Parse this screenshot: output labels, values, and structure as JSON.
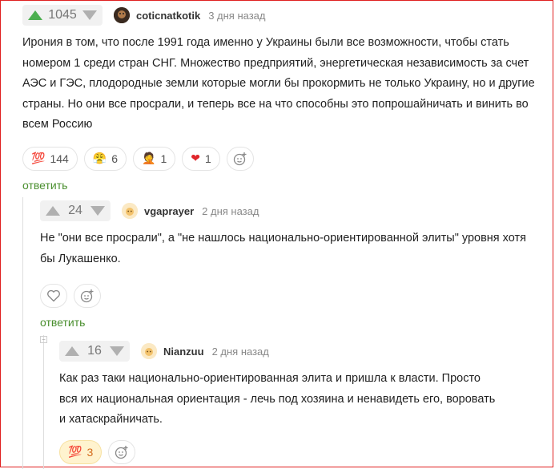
{
  "comments": [
    {
      "rating": "1045",
      "author": "coticnatkotik",
      "time": "3 дня назад",
      "lines": [
        "Ирония в том, что после 1991 года именно у Украины были все возможности, чтобы стать",
        "номером 1 среди стран СНГ. Множество предприятий, энергетическая независимость за счет",
        "АЭС и ГЭС, плодородные земли которые могли бы прокормить не только Украину, но и другие",
        "страны. Но они все просрали, и теперь все на что способны это попрошайничать и винить во",
        "всем Россию"
      ],
      "reactions": [
        {
          "icon": "hundred-emoji",
          "glyph": "💯",
          "count": "144"
        },
        {
          "icon": "angry-face-emoji",
          "glyph": "😤",
          "count": "6"
        },
        {
          "icon": "facepalm-emoji",
          "glyph": "🤦",
          "count": "1"
        },
        {
          "icon": "heart-emoji",
          "glyph": "❤",
          "count": "1"
        }
      ],
      "reply_label": "ответить"
    },
    {
      "rating": "24",
      "author": "vgaprayer",
      "time": "2 дня назад",
      "lines": [
        "Не \"они все просрали\", а \"не нашлось национально-ориентированной элиты\" уровня хотя",
        "бы Лукашенко."
      ],
      "reply_label": "ответить"
    },
    {
      "rating": "16",
      "author": "Nianzuu",
      "time": "2 дня назад",
      "lines": [
        "Как раз таки национально-ориентированная элита и пришла к власти. Просто",
        "вся их национальная ориентация - лечь под хозяина и ненавидеть его, воровать",
        "и хатаскрайничать."
      ],
      "reactions": [
        {
          "icon": "hundred-emoji",
          "glyph": "💯",
          "count": "3"
        }
      ]
    }
  ],
  "colors": {
    "upvote": "#4caf50",
    "downvote": "#b0b0b0",
    "reply": "#4a8f2f"
  }
}
